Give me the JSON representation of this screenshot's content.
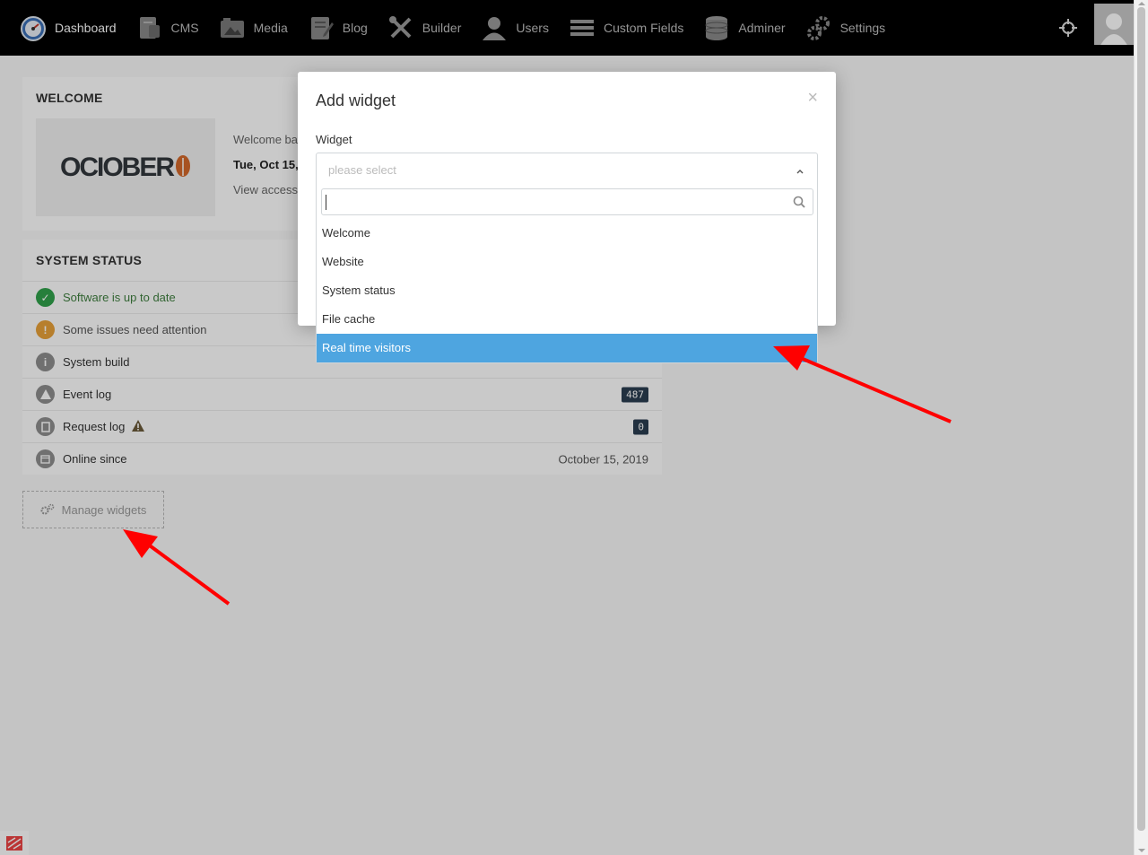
{
  "nav": {
    "items": [
      {
        "label": "Dashboard",
        "icon": "dashboard-icon",
        "active": true
      },
      {
        "label": "CMS",
        "icon": "cms-icon"
      },
      {
        "label": "Media",
        "icon": "media-icon"
      },
      {
        "label": "Blog",
        "icon": "blog-icon"
      },
      {
        "label": "Builder",
        "icon": "builder-icon"
      },
      {
        "label": "Users",
        "icon": "users-icon"
      },
      {
        "label": "Custom Fields",
        "icon": "custom-fields-icon"
      },
      {
        "label": "Adminer",
        "icon": "database-icon"
      },
      {
        "label": "Settings",
        "icon": "settings-icon"
      }
    ]
  },
  "welcome": {
    "title": "WELCOME",
    "logo_main": "OCIOBER",
    "line1": "Welcome ba",
    "line2": "Tue, Oct 15,",
    "line3": "View access"
  },
  "system_status": {
    "title": "SYSTEM STATUS",
    "rows": [
      {
        "label": "Software is up to date",
        "icon": "check-icon",
        "color": "#31a24c"
      },
      {
        "label": "Some issues need attention",
        "icon": "exclamation-icon",
        "color": "#e8a23a"
      },
      {
        "label": "System build",
        "icon": "info-icon",
        "color": "#8e8e8e"
      },
      {
        "label": "Event log",
        "icon": "warning-icon",
        "color": "#8e8e8e",
        "badge": "487"
      },
      {
        "label": "Request log",
        "icon": "file-icon",
        "color": "#8e8e8e",
        "badge": "0"
      },
      {
        "label": "Online since",
        "icon": "calendar-icon",
        "color": "#8e8e8e",
        "value": "October 15, 2019"
      }
    ]
  },
  "manage_widgets": {
    "label": "Manage widgets"
  },
  "modal": {
    "title": "Add widget",
    "close": "×",
    "field_label": "Widget",
    "placeholder": "please select",
    "options": [
      "Welcome",
      "Website",
      "System status",
      "File cache",
      "Real time visitors"
    ],
    "highlighted_option": "Real time visitors"
  },
  "colors": {
    "accent_blue": "#4ea5e0",
    "badge_dark": "#2b3e50",
    "arrow_red": "#ff0000"
  }
}
